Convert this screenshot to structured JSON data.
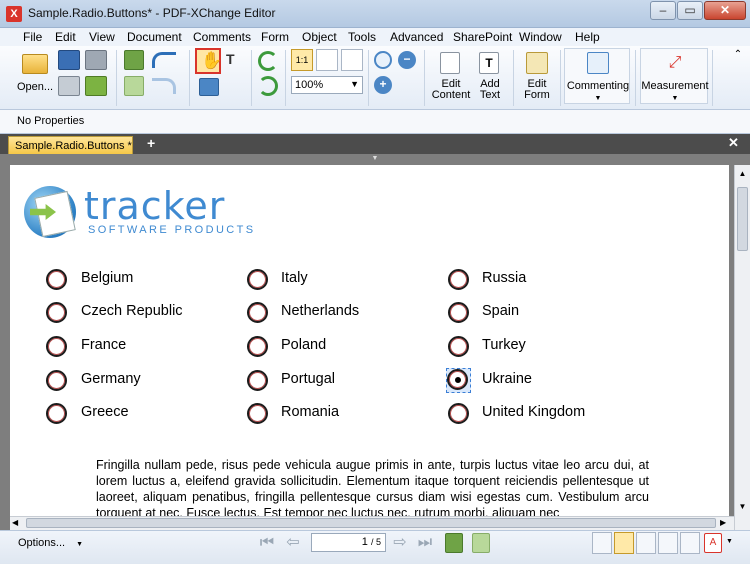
{
  "window": {
    "title": "Sample.Radio.Buttons* - PDF-XChange Editor",
    "app_icon_glyph": "X",
    "controls": [
      "minimize",
      "maximize",
      "close"
    ]
  },
  "menu": [
    "File",
    "Edit",
    "View",
    "Document",
    "Comments",
    "Form",
    "Object",
    "Tools",
    "Advanced",
    "SharePoint",
    "Window",
    "Help"
  ],
  "ribbon": {
    "open_label": "Open...",
    "zoom_value": "100%",
    "edit_content_label_1": "Edit",
    "edit_content_label_2": "Content",
    "add_text_label_1": "Add",
    "add_text_label_2": "Text",
    "edit_form_label_1": "Edit",
    "edit_form_label_2": "Form",
    "commenting_label": "Commenting",
    "measurement_label": "Measurement",
    "accent_color": "#d9342b",
    "active_tool": "hand-tool"
  },
  "properties_bar": {
    "text": "No Properties"
  },
  "tabs": {
    "active_tab": "Sample.Radio.Buttons *",
    "add_glyph": "+",
    "close_glyph": "✕"
  },
  "document": {
    "logo_word": "tracker",
    "logo_sub": "SOFTWARE PRODUCTS",
    "radio_columns": [
      [
        "Belgium",
        "Czech Republic",
        "France",
        "Germany",
        "Greece"
      ],
      [
        "Italy",
        "Netherlands",
        "Poland",
        "Portugal",
        "Romania"
      ],
      [
        "Russia",
        "Spain",
        "Turkey",
        "Ukraine",
        "United Kingdom"
      ]
    ],
    "selected_option": "Ukraine",
    "paragraph": "Fringilla nullam pede, risus pede vehicula augue primis in ante, turpis luctus vitae leo arcu dui, at lorem luctus a, eleifend gravida sollicitudin. Elementum itaque torquent reiciendis pellentesque ut laoreet, aliquam penatibus, fringilla pellentesque cursus diam wisi egestas cum. Vestibulum arcu torquent at nec. Fusce lectus. Est tempor nec luctus nec, rutrum morbi, aliquam nec"
  },
  "status": {
    "options_label": "Options...",
    "page_current": "1",
    "page_total": "/ 5"
  }
}
